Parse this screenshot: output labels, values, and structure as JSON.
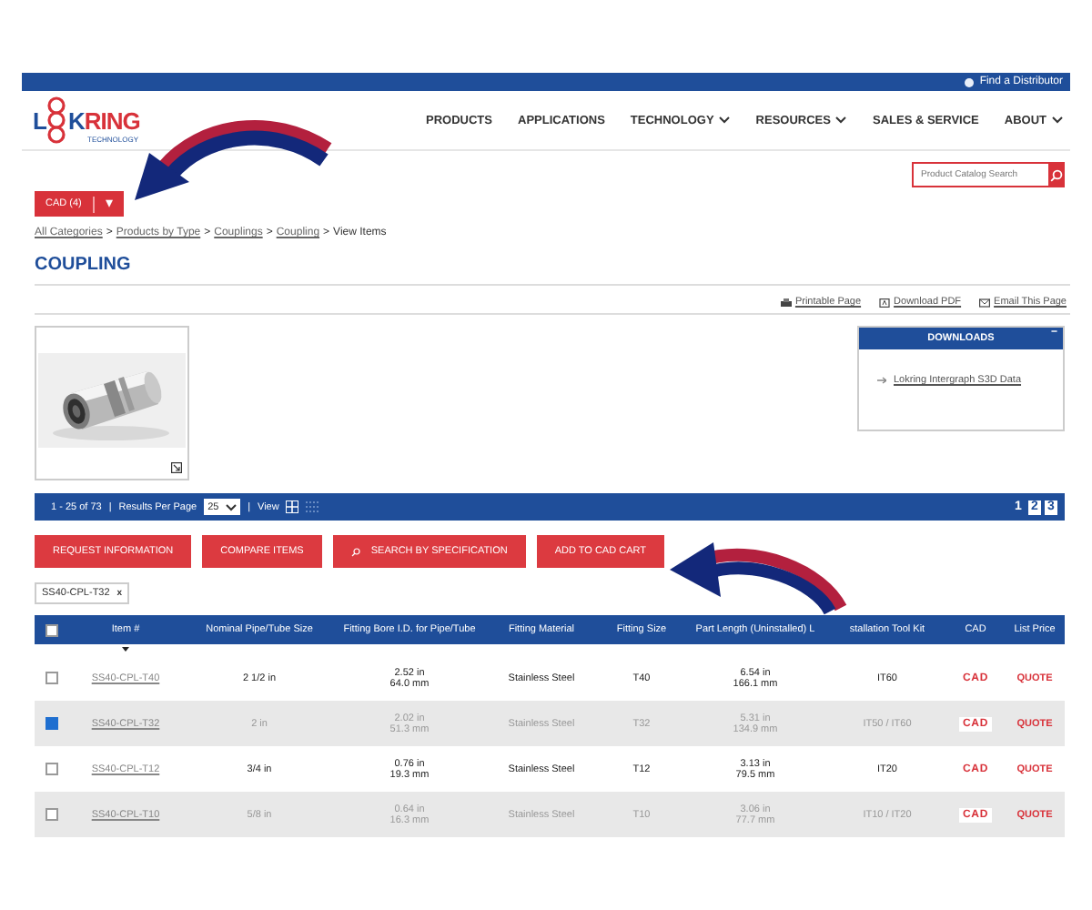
{
  "top_bar": {
    "link": "Find a Distributor"
  },
  "logo": {
    "text_left": "L",
    "text_mid": "K",
    "text_right": "RING",
    "tagline": "TECHNOLOGY"
  },
  "nav": [
    {
      "label": "PRODUCTS",
      "dropdown": false
    },
    {
      "label": "APPLICATIONS",
      "dropdown": false
    },
    {
      "label": "TECHNOLOGY",
      "dropdown": true
    },
    {
      "label": "RESOURCES",
      "dropdown": true
    },
    {
      "label": "SALES & SERVICE",
      "dropdown": false
    },
    {
      "label": "ABOUT",
      "dropdown": true
    }
  ],
  "search": {
    "placeholder": "Product Catalog Search"
  },
  "cad_button": {
    "label": "CAD (4)",
    "caret": "▾"
  },
  "breadcrumb": [
    {
      "kind": "link",
      "label": "All Categories"
    },
    {
      "kind": "separator",
      "label": ">"
    },
    {
      "kind": "link",
      "label": "Products by Type"
    },
    {
      "kind": "separator",
      "label": ">"
    },
    {
      "kind": "link",
      "label": "Couplings"
    },
    {
      "kind": "separator",
      "label": ">"
    },
    {
      "kind": "link",
      "label": "Coupling"
    },
    {
      "kind": "separator",
      "label": ">"
    },
    {
      "kind": "current",
      "label": "View Items"
    }
  ],
  "title": "COUPLING",
  "page_links": [
    {
      "kind": "print",
      "label": "Printable Page"
    },
    {
      "kind": "pdf",
      "label": "Download PDF"
    },
    {
      "kind": "email",
      "label": "Email This Page"
    }
  ],
  "downloads": {
    "title": "DOWNLOADS",
    "collapse": "−",
    "items": [
      "Lokring Intergraph S3D Data"
    ]
  },
  "results_bar": {
    "range": "1 - 25 of 73",
    "separators": [
      "|",
      "|"
    ],
    "per_page_label": "Results Per Page",
    "per_page": "25",
    "view_label": "View",
    "views": [
      {
        "kind": "grid",
        "selected": true
      },
      {
        "kind": "list",
        "selected": false
      }
    ],
    "pages": [
      {
        "label": "1",
        "selected": true
      },
      {
        "label": "2",
        "selected": false
      },
      {
        "label": "3",
        "selected": false
      }
    ]
  },
  "actions": [
    {
      "label": "REQUEST INFORMATION",
      "icon": false
    },
    {
      "label": "COMPARE ITEMS",
      "icon": false
    },
    {
      "label": "SEARCH BY SPECIFICATION",
      "icon": true
    },
    {
      "label": "ADD TO CAD CART",
      "icon": false
    }
  ],
  "filter_tag": {
    "label": "SS40-CPL-T32",
    "remove": "x"
  },
  "table": {
    "columns": [
      "Item #",
      "Nominal Pipe/Tube Size",
      "Fitting Bore I.D. for Pipe/Tube",
      "Fitting Material",
      "Fitting Size",
      "Part Length (Uninstalled) L",
      "stallation Tool Kit",
      "CAD",
      "List Price"
    ],
    "select_all": false,
    "rows": [
      {
        "checked": false,
        "item": "SS40-CPL-T40",
        "nominal": "2 1/2 in",
        "bore": [
          "2.52 in",
          "64.0 mm"
        ],
        "material": "Stainless Steel",
        "size": "T40",
        "length": [
          "6.54 in",
          "166.1 mm"
        ],
        "tool": "IT60",
        "cad": "CAD",
        "price": "QUOTE"
      },
      {
        "checked": true,
        "item": "SS40-CPL-T32",
        "nominal": "2 in",
        "bore": [
          "2.02 in",
          "51.3 mm"
        ],
        "material": "Stainless Steel",
        "size": "T32",
        "length": [
          "5.31 in",
          "134.9 mm"
        ],
        "tool": "IT50 / IT60",
        "cad": "CAD",
        "price": "QUOTE"
      },
      {
        "checked": false,
        "item": "SS40-CPL-T12",
        "nominal": "3/4 in",
        "bore": [
          "0.76 in",
          "19.3 mm"
        ],
        "material": "Stainless Steel",
        "size": "T12",
        "length": [
          "3.13 in",
          "79.5 mm"
        ],
        "tool": "IT20",
        "cad": "CAD",
        "price": "QUOTE"
      },
      {
        "checked": false,
        "item": "SS40-CPL-T10",
        "nominal": "5/8 in",
        "bore": [
          "0.64 in",
          "16.3 mm"
        ],
        "material": "Stainless Steel",
        "size": "T10",
        "length": [
          "3.06 in",
          "77.7 mm"
        ],
        "tool": "IT10 / IT20",
        "cad": "CAD",
        "price": "QUOTE"
      }
    ]
  }
}
